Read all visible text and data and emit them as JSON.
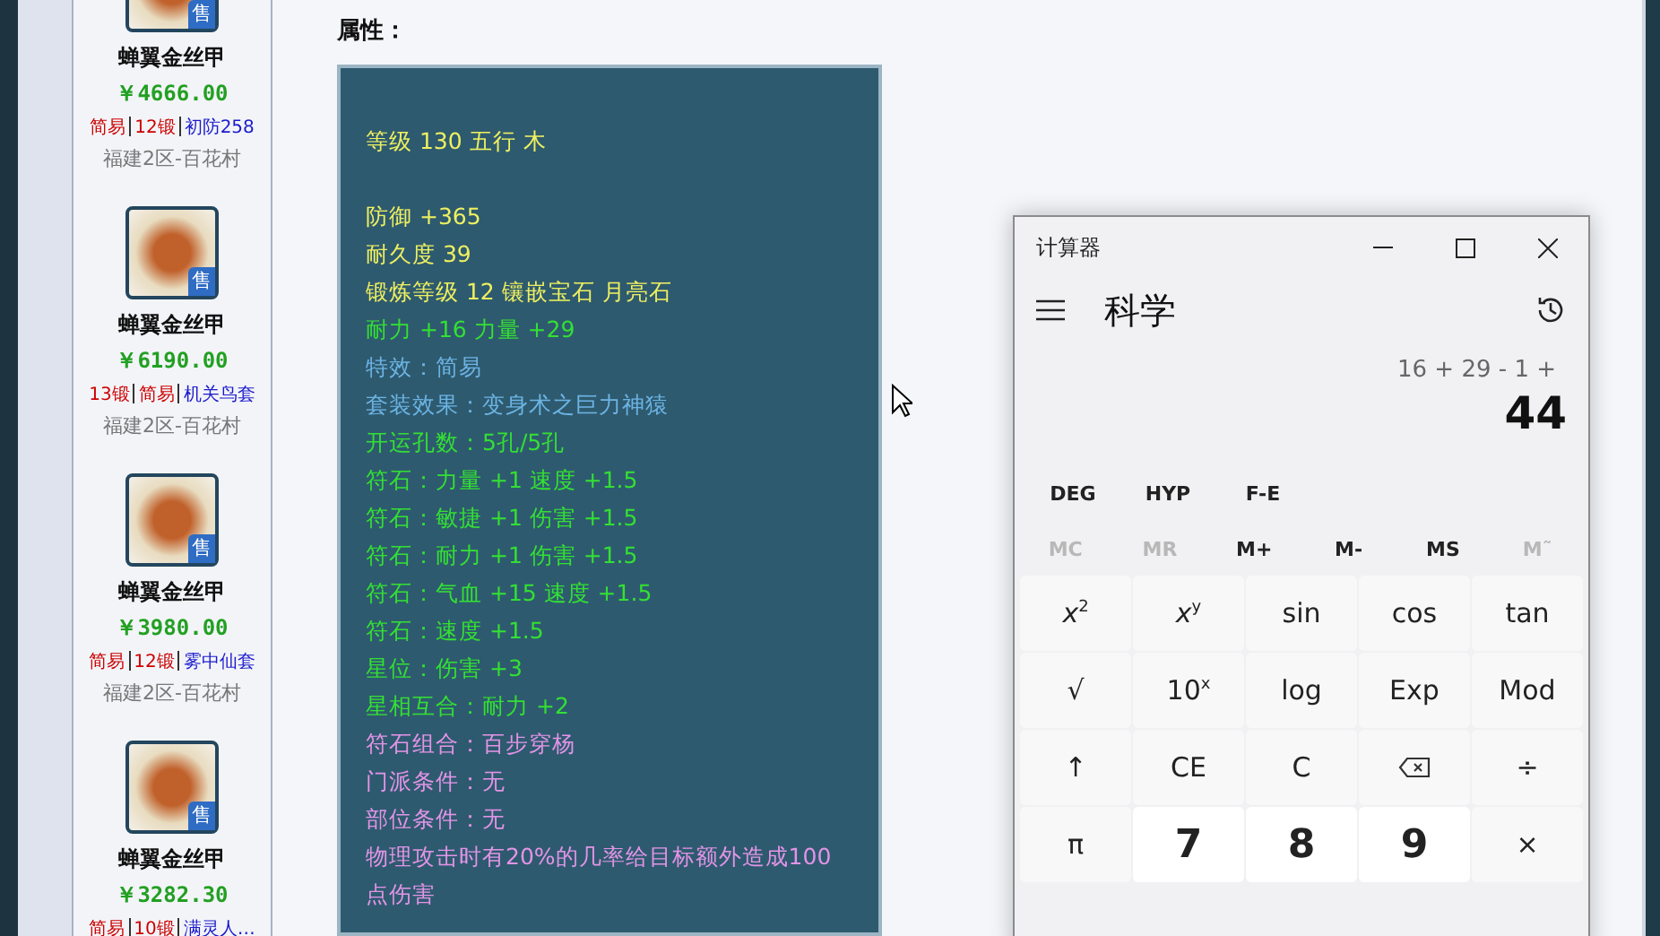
{
  "listings": [
    {
      "badge": "售",
      "name": "蝉翼金丝甲",
      "price": "￥4666.00",
      "tags": [
        {
          "text": "简易",
          "color": "#cc0000"
        },
        {
          "text": "12锻",
          "color": "#cc0000"
        },
        {
          "text": "初防258",
          "color": "#1a1acc"
        }
      ],
      "location": "福建2区-百花村"
    },
    {
      "badge": "售",
      "name": "蝉翼金丝甲",
      "price": "￥6190.00",
      "tags": [
        {
          "text": "13锻",
          "color": "#cc0000"
        },
        {
          "text": "简易",
          "color": "#cc0000"
        },
        {
          "text": "机关鸟套",
          "color": "#1a1acc"
        }
      ],
      "location": "福建2区-百花村"
    },
    {
      "badge": "售",
      "name": "蝉翼金丝甲",
      "price": "￥3980.00",
      "tags": [
        {
          "text": "简易",
          "color": "#cc0000"
        },
        {
          "text": "12锻",
          "color": "#cc0000"
        },
        {
          "text": "雾中仙套",
          "color": "#1a1acc"
        }
      ],
      "location": "福建2区-百花村"
    },
    {
      "badge": "售",
      "name": "蝉翼金丝甲",
      "price": "￥3282.30",
      "tags": [
        {
          "text": "简易",
          "color": "#cc0000"
        },
        {
          "text": "10锻",
          "color": "#cc0000"
        },
        {
          "text": "满灵人…",
          "color": "#1a1acc"
        }
      ]
    }
  ],
  "attributes": {
    "heading": "属性：",
    "groups": [
      [
        {
          "text": "等级 130 五行 木",
          "kind": "base"
        }
      ],
      [
        {
          "text": "防御 +365",
          "kind": "base"
        },
        {
          "text": "耐久度 39",
          "kind": "base"
        },
        {
          "text": "锻炼等级 12 镶嵌宝石 月亮石",
          "kind": "base"
        },
        {
          "text": "耐力 +16 力量 +29",
          "kind": "bonus"
        },
        {
          "text": "特效：简易",
          "kind": "effect"
        },
        {
          "text": "套装效果：变身术之巨力神猿",
          "kind": "effect"
        },
        {
          "text": "开运孔数：5孔/5孔",
          "kind": "bonus"
        },
        {
          "text": "符石：力量 +1 速度 +1.5",
          "kind": "bonus"
        },
        {
          "text": "符石：敏捷 +1 伤害 +1.5",
          "kind": "bonus"
        },
        {
          "text": "符石：耐力 +1 伤害 +1.5",
          "kind": "bonus"
        },
        {
          "text": "符石：气血 +15 速度 +1.5",
          "kind": "bonus"
        },
        {
          "text": "符石：速度 +1.5",
          "kind": "bonus"
        },
        {
          "text": "星位：伤害 +3",
          "kind": "bonus"
        },
        {
          "text": "星相互合：耐力 +2",
          "kind": "bonus"
        },
        {
          "text": "符石组合：百步穿杨",
          "kind": "combo"
        },
        {
          "text": "门派条件：无",
          "kind": "combo"
        },
        {
          "text": "部位条件：无",
          "kind": "combo"
        },
        {
          "text": "物理攻击时有20%的几率给目标额外造成100点伤害",
          "kind": "combo"
        }
      ]
    ]
  },
  "calculator": {
    "title": "计算器",
    "mode": "科学",
    "expression": "16 + 29 - 1 +",
    "result": "44",
    "toggles": [
      "DEG",
      "HYP",
      "F-E"
    ],
    "memory": [
      {
        "label": "MC",
        "disabled": true
      },
      {
        "label": "MR",
        "disabled": true
      },
      {
        "label": "M+",
        "disabled": false
      },
      {
        "label": "M-",
        "disabled": false
      },
      {
        "label": "MS",
        "disabled": false
      },
      {
        "label": "M˜",
        "disabled": true
      }
    ],
    "keys": [
      {
        "label": "*x*$^{2}$",
        "kind": "function"
      },
      {
        "label": "*x*$^{y}$",
        "kind": "function"
      },
      {
        "label": "sin",
        "kind": "function"
      },
      {
        "label": "cos",
        "kind": "function"
      },
      {
        "label": "tan",
        "kind": "function"
      },
      {
        "label": "√",
        "kind": "function"
      },
      {
        "label": "10$^{x}$",
        "kind": "function"
      },
      {
        "label": "log",
        "kind": "function"
      },
      {
        "label": "Exp",
        "kind": "function"
      },
      {
        "label": "Mod",
        "kind": "function"
      },
      {
        "label": "↑",
        "kind": "function"
      },
      {
        "label": "CE",
        "kind": "function"
      },
      {
        "label": "C",
        "kind": "function"
      },
      {
        "kind": "backspace"
      },
      {
        "label": "÷",
        "kind": "function"
      },
      {
        "label": "π",
        "kind": "function"
      },
      {
        "label": "7",
        "kind": "digit"
      },
      {
        "label": "8",
        "kind": "digit"
      },
      {
        "label": "9",
        "kind": "digit"
      },
      {
        "label": "×",
        "kind": "function"
      }
    ]
  }
}
